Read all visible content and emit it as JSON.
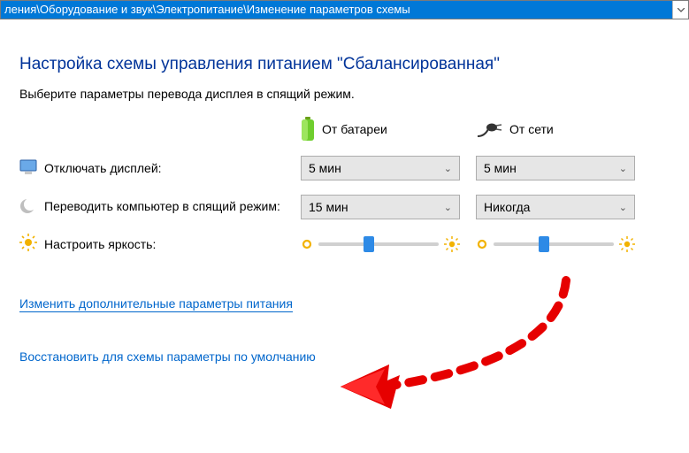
{
  "address_bar": "ления\\Оборудование и звук\\Электропитание\\Изменение параметров схемы",
  "page_title": "Настройка схемы управления питанием \"Сбалансированная\"",
  "subtitle": "Выберите параметры перевода дисплея в спящий режим.",
  "columns": {
    "battery": "От батареи",
    "plugged": "От сети"
  },
  "rows": {
    "display_off": {
      "label": "Отключать дисплей:",
      "battery": "5 мин",
      "plugged": "5 мин"
    },
    "sleep": {
      "label": "Переводить компьютер в спящий режим:",
      "battery": "15 мин",
      "plugged": "Никогда"
    },
    "brightness": {
      "label": "Настроить яркость:",
      "battery_pct": 42,
      "plugged_pct": 42
    }
  },
  "links": {
    "advanced": "Изменить дополнительные параметры питания",
    "restore": "Восстановить для схемы параметры по умолчанию"
  }
}
